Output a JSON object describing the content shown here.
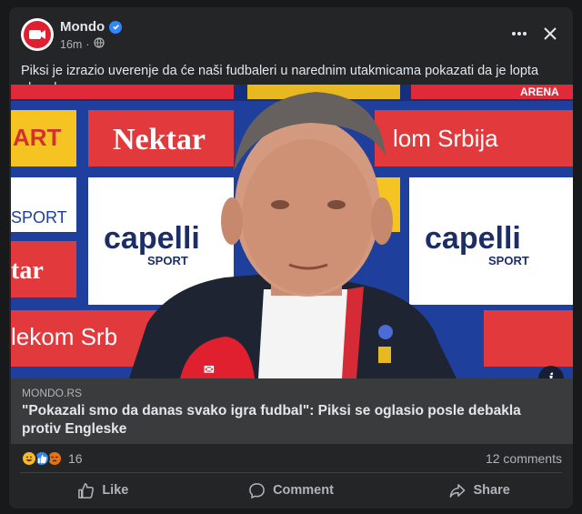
{
  "post": {
    "page_name": "Mondo",
    "time": "16m",
    "separator": "·",
    "text": "Piksi je izrazio uverenje da će naši fudbaleri u narednim utakmicama pokazati da je lopta okrugla"
  },
  "media": {
    "icon": "info-icon",
    "sponsor_texts": {
      "nektar": "Nektar",
      "capelli_left": "capelli",
      "capelli_left_sub": "SPORT",
      "capelli_right": "capelli",
      "capelli_right_sub": "SPORT",
      "srbija_top": "lom Srbija",
      "srbija_left": "lekom Srb",
      "art": "ART",
      "tar": "tar",
      "sport_small": "SPORT",
      "arena": "ARENA"
    }
  },
  "link": {
    "domain": "MONDO.RS",
    "title": "\"Pokazali smo da danas svako igra fudbal\": Piksi se oglasio posle debakla protiv Engleske"
  },
  "stats": {
    "reaction_count": "16",
    "comments": "12 comments",
    "reaction_icons": [
      "haha-icon",
      "like-icon",
      "angry-icon"
    ]
  },
  "actions": {
    "like": "Like",
    "comment": "Comment",
    "share": "Share"
  },
  "colors": {
    "background": "#18191a",
    "card": "#242526",
    "accent": "#2d88ff",
    "brand_red": "#e0202f"
  }
}
